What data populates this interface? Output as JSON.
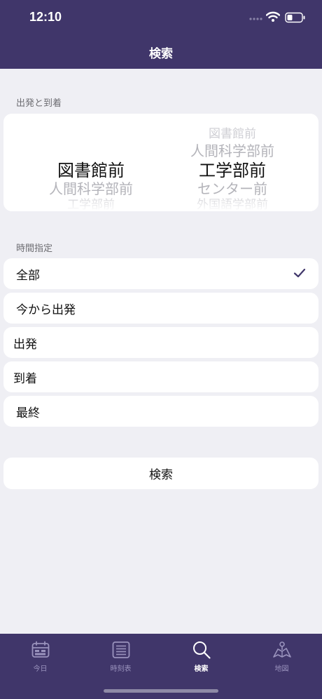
{
  "status_bar": {
    "time": "12:10"
  },
  "nav": {
    "title": "検索"
  },
  "route": {
    "section_label": "出発と到着",
    "departure": {
      "above": "",
      "selected": "図書館前",
      "below1": "人間科学部前",
      "below2": "工学部前"
    },
    "arrival": {
      "above2": "図書館前",
      "above1": "人間科学部前",
      "selected": "工学部前",
      "below1": "センター前",
      "below2": "外国語学部前"
    }
  },
  "time": {
    "section_label": "時間指定",
    "options": [
      {
        "label": "全部",
        "selected": true
      },
      {
        "label": "今から出発",
        "selected": false
      },
      {
        "label": "出発",
        "selected": false
      },
      {
        "label": "到着",
        "selected": false
      },
      {
        "label": "最終",
        "selected": false
      }
    ]
  },
  "search_button": {
    "label": "検索"
  },
  "tabbar": {
    "tabs": [
      {
        "label": "今日",
        "icon": "calendar-icon"
      },
      {
        "label": "時刻表",
        "icon": "list-icon"
      },
      {
        "label": "検索",
        "icon": "search-icon",
        "active": true
      },
      {
        "label": "地図",
        "icon": "map-icon"
      }
    ]
  },
  "colors": {
    "accent": "#40366a",
    "background": "#efeff4",
    "check": "#40366a"
  }
}
